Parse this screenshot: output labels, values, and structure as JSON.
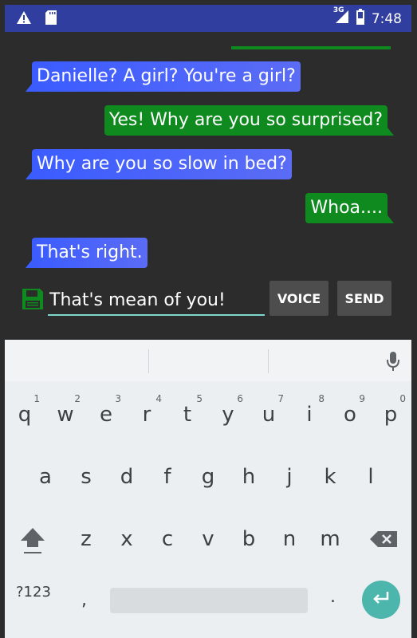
{
  "status_bar": {
    "time": "7:48",
    "network": "3G",
    "icons": [
      "warning-icon",
      "sd-card-icon",
      "signal-icon",
      "battery-icon"
    ]
  },
  "messages": [
    {
      "text": "Danielle? A girl? You're a girl?",
      "from": "other"
    },
    {
      "text": "Yes! Why are you so surprised?",
      "from": "me"
    },
    {
      "text": "Why are you so slow in bed?",
      "from": "other"
    },
    {
      "text": "Whoa....",
      "from": "me"
    },
    {
      "text": "That's right.",
      "from": "other"
    }
  ],
  "compose": {
    "input_value": "That's mean of you!",
    "voice_label": "VOICE",
    "send_label": "SEND"
  },
  "keyboard": {
    "row1": [
      {
        "key": "q",
        "hint": "1"
      },
      {
        "key": "w",
        "hint": "2"
      },
      {
        "key": "e",
        "hint": "3"
      },
      {
        "key": "r",
        "hint": "4"
      },
      {
        "key": "t",
        "hint": "5"
      },
      {
        "key": "y",
        "hint": "6"
      },
      {
        "key": "u",
        "hint": "7"
      },
      {
        "key": "i",
        "hint": "8"
      },
      {
        "key": "o",
        "hint": "9"
      },
      {
        "key": "p",
        "hint": "0"
      }
    ],
    "row2": [
      "a",
      "s",
      "d",
      "f",
      "g",
      "h",
      "j",
      "k",
      "l"
    ],
    "row3": [
      "z",
      "x",
      "c",
      "v",
      "b",
      "n",
      "m"
    ],
    "symbols_label": "?123",
    "comma": ",",
    "period": "."
  },
  "colors": {
    "status_bar": "#303f9f",
    "received_bubble": "#4a63fb",
    "sent_bubble": "#0e8a1f",
    "input_underline": "#7fd6cc",
    "enter_key": "#4db6ac"
  }
}
